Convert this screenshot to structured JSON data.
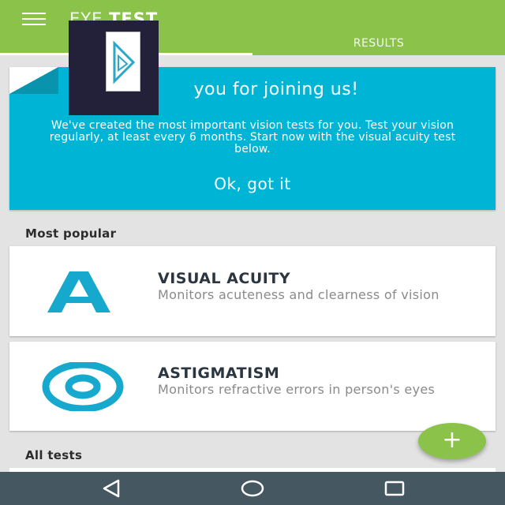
{
  "app_bar": {
    "title_part1": "EYE",
    "title_part2": "TEST",
    "tabs": [
      {
        "label": ""
      },
      {
        "label": "RESULTS"
      }
    ],
    "color": "#8bc34a"
  },
  "welcome_card": {
    "title": "you for joining us!",
    "text": "We've created the most important vision tests for you. Test your vision regularly, at least every 6 months. Start now with the visual acuity test below.",
    "action": "Ok, got it",
    "color": "#00b4d6"
  },
  "sections": {
    "popular_heading": "Most popular",
    "all_heading": "All tests"
  },
  "tests": [
    {
      "title": "VISUAL ACUITY",
      "description": "Monitors acuteness and clearness of vision",
      "icon": "letter-a-icon"
    },
    {
      "title": "ASTIGMATISM",
      "description": "Monitors refractive errors in person's eyes",
      "icon": "concentric-circles-icon"
    }
  ],
  "fab": {
    "label": "+"
  },
  "nav": {
    "buttons": [
      "back-icon",
      "home-icon",
      "recents-icon"
    ]
  }
}
